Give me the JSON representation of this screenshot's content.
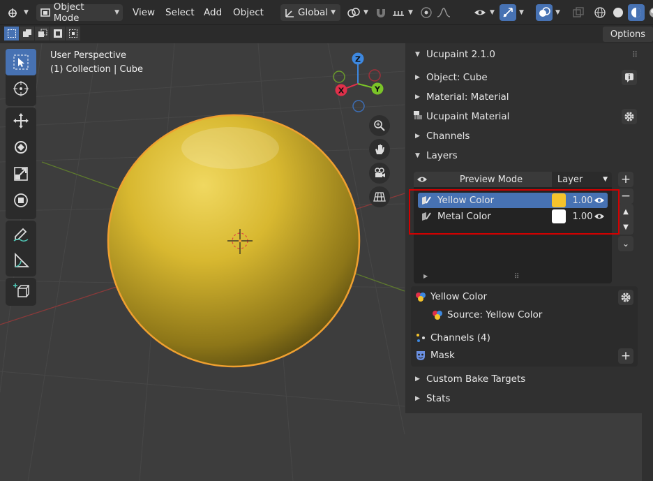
{
  "header": {
    "mode": "Object Mode",
    "menus": [
      "View",
      "Select",
      "Add",
      "Object"
    ],
    "orientation": "Global",
    "options_label": "Options"
  },
  "viewport": {
    "perspective": "User Perspective",
    "collection_line": "(1) Collection | Cube",
    "gizmo": {
      "z": "Z",
      "x": "X",
      "y": "Y"
    }
  },
  "sidebar": {
    "title": "Ucupaint 2.1.0",
    "panels": {
      "object": "Object: Cube",
      "material": "Material: Material",
      "ucupaint_material": "Ucupaint Material",
      "channels": "Channels",
      "layers": "Layers",
      "custom_bake": "Custom Bake Targets",
      "stats": "Stats"
    },
    "layers_header": {
      "preview": "Preview Mode",
      "layer_select": "Layer"
    },
    "layers": [
      {
        "name": "Yellow Color",
        "value": "1.00",
        "color": "#f5c32c",
        "active": true
      },
      {
        "name": "Metal Color",
        "value": "1.00",
        "color": "#ffffff",
        "active": false
      }
    ],
    "details": {
      "layer_name": "Yellow Color",
      "source": "Source: Yellow Color",
      "channels": "Channels (4)",
      "mask": "Mask"
    }
  },
  "colors": {
    "accent": "#4772b3",
    "highlight": "#d40000",
    "sphere": "#d4b22a",
    "outline": "#f0a030"
  }
}
